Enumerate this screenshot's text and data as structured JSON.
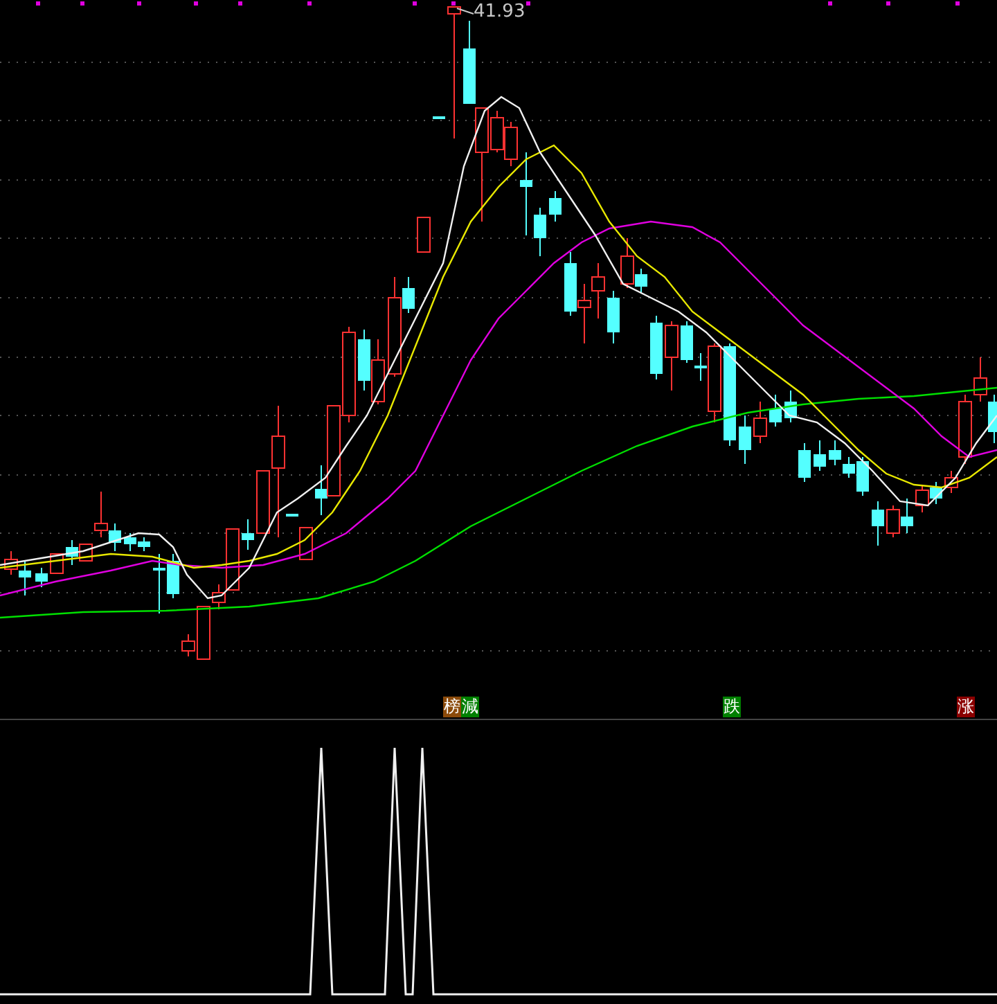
{
  "price_label": "41.93",
  "signals": [
    {
      "label": "榜",
      "color": "#8b4a0a"
    },
    {
      "label": "減",
      "color": "#008000"
    },
    {
      "label": "跌",
      "color": "#008000"
    },
    {
      "label": "涨",
      "color": "#8b0000"
    }
  ]
}
